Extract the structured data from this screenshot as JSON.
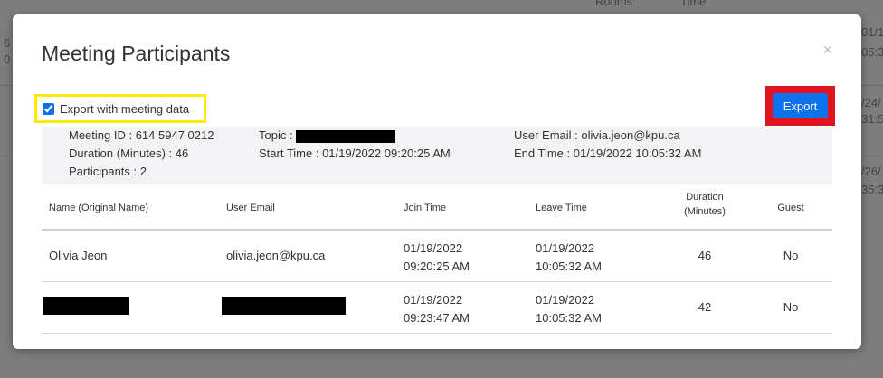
{
  "modal": {
    "title": "Meeting Participants",
    "close_glyph": "×",
    "export_checkbox_label": "Export with meeting data",
    "export_checkbox_checked": true,
    "export_button_label": "Export"
  },
  "summary": {
    "meeting_id": "Meeting ID : 614 5947 0212",
    "duration": "Duration (Minutes) : 46",
    "participants": "Participants : 2",
    "topic_label": "Topic :",
    "start_time": "Start Time : 01/19/2022 09:20:25 AM",
    "user_email": "User Email : olivia.jeon@kpu.ca",
    "end_time": "End Time : 01/19/2022 10:05:32 AM"
  },
  "table": {
    "headers": {
      "name": "Name (Original Name)",
      "email": "User Email",
      "join": "Join Time",
      "leave": "Leave Time",
      "duration_1": "Duration",
      "duration_2": "(Minutes)",
      "guest": "Guest"
    },
    "rows": [
      {
        "name": "Olivia Jeon",
        "email": "olivia.jeon@kpu.ca",
        "join_date": "01/19/2022",
        "join_time": "09:20:25 AM",
        "leave_date": "01/19/2022",
        "leave_time": "10:05:32 AM",
        "duration": "46",
        "guest": "No"
      },
      {
        "join_date": "01/19/2022",
        "join_time": "09:23:47 AM",
        "leave_date": "01/19/2022",
        "leave_time": "10:05:32 AM",
        "duration": "42",
        "guest": "No"
      }
    ]
  },
  "background": {
    "rooms": "Rooms:",
    "time": "Time",
    "left_a": "6",
    "left_b": "0",
    "right_a": "01/19/",
    "right_b": "05:3",
    "right_c": "/24/",
    "right_d": "31:5",
    "right_e": "/26/",
    "right_f": "35:3"
  },
  "colors": {
    "primary": "#0e72ed",
    "highlight_yellow": "#ffea00",
    "highlight_red": "#e0131f",
    "overlay": "#7d7d7d"
  }
}
